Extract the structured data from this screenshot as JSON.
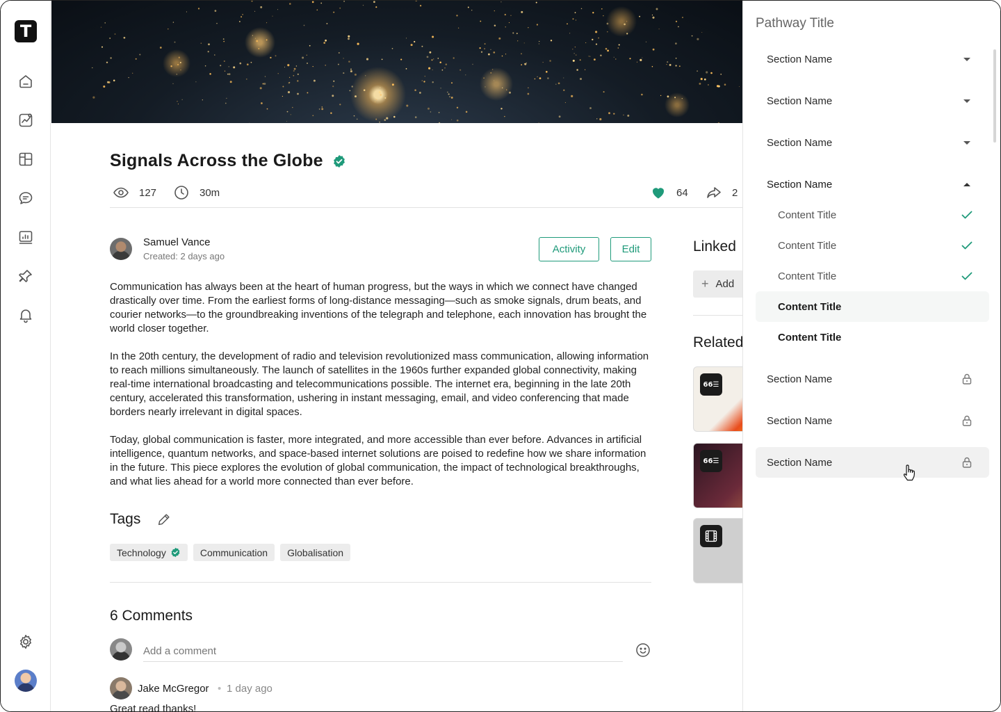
{
  "app": {
    "logo_letter": "T"
  },
  "nav": {
    "items": [
      "home-icon",
      "analytics-icon",
      "layout-icon",
      "chat-icon",
      "report-icon",
      "pin-icon",
      "bell-icon"
    ],
    "bottom": [
      "gear-icon",
      "avatar"
    ]
  },
  "article": {
    "title": "Signals Across the Globe",
    "views": "127",
    "duration": "30m",
    "likes": "64",
    "shares": "2",
    "author": {
      "name": "Samuel Vance",
      "created": "Created: 2 days ago"
    },
    "buttons": {
      "activity": "Activity",
      "edit": "Edit"
    },
    "paragraphs": [
      "Communication has always been at the heart of human progress, but the ways in which we connect have changed drastically over time. From the earliest forms of long-distance messaging—such as smoke signals, drum beats, and courier networks—to the groundbreaking inventions of the telegraph and telephone, each innovation has brought the world closer together.",
      "In the 20th century, the development of radio and television revolutionized mass communication, allowing information to reach millions simultaneously. The launch of satellites in the 1960s further expanded global connectivity, making real-time international broadcasting and telecommunications possible. The internet era, beginning in the late 20th century, accelerated this transformation, ushering in instant messaging, email, and video conferencing that made borders nearly irrelevant in digital spaces.",
      "Today, global communication is faster, more integrated, and more accessible than ever before. Advances in artificial intelligence, quantum networks, and space-based internet solutions are poised to redefine how we share information in the future. This piece explores the evolution of global communication, the impact of technological breakthroughs, and what lies ahead for a world more connected than ever before."
    ],
    "tags_title": "Tags",
    "tags": [
      "Technology",
      "Communication",
      "Globalisation"
    ],
    "comments_title": "6 Comments",
    "comment_placeholder": "Add a comment",
    "comments": [
      {
        "name": "Jake McGregor",
        "time": "1 day ago",
        "text": "Great read thanks!"
      }
    ]
  },
  "side": {
    "linked_title": "Linked",
    "add_label": "Add",
    "related_title": "Related",
    "cards": [
      {
        "icon": "quote-list-icon",
        "glyph": "66"
      },
      {
        "icon": "quote-list-icon",
        "glyph": "66"
      },
      {
        "icon": "film-icon",
        "glyph": ""
      }
    ]
  },
  "pathway": {
    "title": "Pathway Title",
    "rows": [
      {
        "kind": "section",
        "label": "Section Name",
        "state": "collapsed"
      },
      {
        "kind": "section",
        "label": "Section Name",
        "state": "collapsed"
      },
      {
        "kind": "section",
        "label": "Section Name",
        "state": "collapsed"
      },
      {
        "kind": "section",
        "label": "Section Name",
        "state": "expanded"
      },
      {
        "kind": "content",
        "label": "Content Title",
        "state": "done"
      },
      {
        "kind": "content",
        "label": "Content Title",
        "state": "done"
      },
      {
        "kind": "content",
        "label": "Content Title",
        "state": "done"
      },
      {
        "kind": "content",
        "label": "Content Title",
        "state": "current"
      },
      {
        "kind": "content",
        "label": "Content Title",
        "state": "next"
      },
      {
        "kind": "section",
        "label": "Section Name",
        "state": "locked"
      },
      {
        "kind": "section",
        "label": "Section Name",
        "state": "locked"
      },
      {
        "kind": "section",
        "label": "Section Name",
        "state": "locked-hover"
      }
    ]
  },
  "colors": {
    "accent": "#1f9a7a",
    "text": "#1f1f1f",
    "muted": "#777777"
  }
}
